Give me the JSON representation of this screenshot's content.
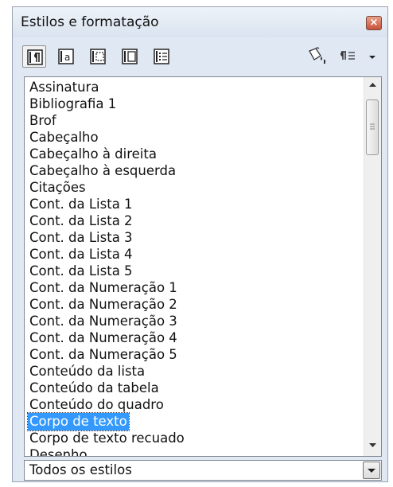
{
  "window": {
    "title": "Estilos e formatação"
  },
  "toolbar": {
    "buttons": [
      {
        "icon": "paragraph-styles-icon",
        "active": true
      },
      {
        "icon": "character-styles-icon",
        "active": false
      },
      {
        "icon": "frame-styles-icon",
        "active": false
      },
      {
        "icon": "page-styles-icon",
        "active": false
      },
      {
        "icon": "list-styles-icon",
        "active": false
      }
    ],
    "right_icons": [
      "fill-format-mode-icon",
      "new-style-from-selection-icon",
      "dropdown-arrow-icon"
    ]
  },
  "styles_list": {
    "items": [
      "Assinatura",
      "Bibliografia 1",
      "Brof",
      "Cabeçalho",
      "Cabeçalho à direita",
      "Cabeçalho à esquerda",
      "Citações",
      "Cont. da Lista 1",
      "Cont. da Lista 2",
      "Cont. da Lista 3",
      "Cont. da Lista 4",
      "Cont. da Lista 5",
      "Cont. da Numeração 1",
      "Cont. da Numeração 2",
      "Cont. da Numeração 3",
      "Cont. da Numeração 4",
      "Cont. da Numeração 5",
      "Conteúdo da lista",
      "Conteúdo da tabela",
      "Conteúdo do quadro",
      "Corpo de texto",
      "Corpo de texto recuado",
      "Desenho"
    ],
    "selected": "Corpo de texto"
  },
  "filter": {
    "value": "Todos os estilos"
  },
  "colors": {
    "selection": "#3399ff",
    "panel_background": "#dfe8f3"
  }
}
